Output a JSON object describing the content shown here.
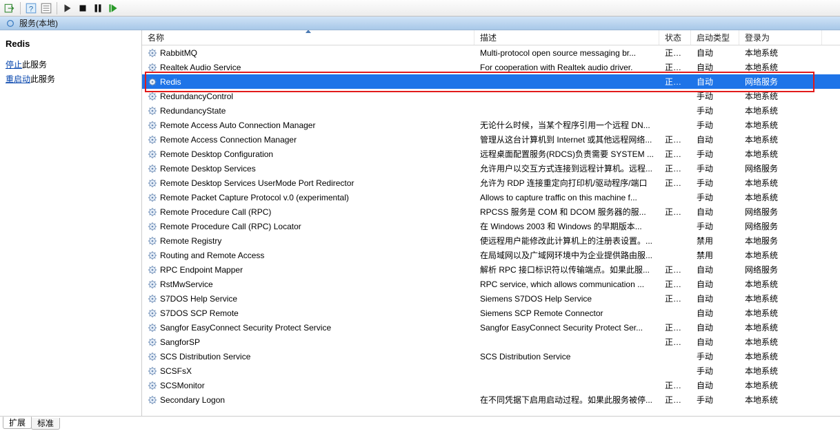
{
  "header": {
    "title": "服务(本地)"
  },
  "left_pane": {
    "title": "Redis",
    "links": [
      {
        "link": "停止",
        "suffix": "此服务"
      },
      {
        "link": "重启动",
        "suffix": "此服务"
      }
    ]
  },
  "columns": {
    "name": "名称",
    "desc": "描述",
    "status": "状态",
    "startup": "启动类型",
    "logon": "登录为"
  },
  "selected_index": 2,
  "services": [
    {
      "name": "RabbitMQ",
      "desc": "Multi-protocol open source messaging br...",
      "status": "正在...",
      "startup": "自动",
      "logon": "本地系统"
    },
    {
      "name": "Realtek Audio Service",
      "desc": "For cooperation with Realtek audio driver.",
      "status": "正在...",
      "startup": "自动",
      "logon": "本地系统"
    },
    {
      "name": "Redis",
      "desc": "",
      "status": "正在...",
      "startup": "自动",
      "logon": "网络服务"
    },
    {
      "name": "RedundancyControl",
      "desc": "",
      "status": "",
      "startup": "手动",
      "logon": "本地系统"
    },
    {
      "name": "RedundancyState",
      "desc": "",
      "status": "",
      "startup": "手动",
      "logon": "本地系统"
    },
    {
      "name": "Remote Access Auto Connection Manager",
      "desc": "无论什么时候，当某个程序引用一个远程 DN...",
      "status": "",
      "startup": "手动",
      "logon": "本地系统"
    },
    {
      "name": "Remote Access Connection Manager",
      "desc": "管理从这台计算机到 Internet 或其他远程网络...",
      "status": "正在...",
      "startup": "自动",
      "logon": "本地系统"
    },
    {
      "name": "Remote Desktop Configuration",
      "desc": "远程桌面配置服务(RDCS)负责需要 SYSTEM ...",
      "status": "正在...",
      "startup": "手动",
      "logon": "本地系统"
    },
    {
      "name": "Remote Desktop Services",
      "desc": "允许用户以交互方式连接到远程计算机。远程...",
      "status": "正在...",
      "startup": "手动",
      "logon": "网络服务"
    },
    {
      "name": "Remote Desktop Services UserMode Port Redirector",
      "desc": "允许为 RDP 连接重定向打印机/驱动程序/端口",
      "status": "正在...",
      "startup": "手动",
      "logon": "本地系统"
    },
    {
      "name": "Remote Packet Capture Protocol v.0 (experimental)",
      "desc": "Allows to capture traffic on this machine f...",
      "status": "",
      "startup": "手动",
      "logon": "本地系统"
    },
    {
      "name": "Remote Procedure Call (RPC)",
      "desc": "RPCSS 服务是 COM 和 DCOM 服务器的服...",
      "status": "正在...",
      "startup": "自动",
      "logon": "网络服务"
    },
    {
      "name": "Remote Procedure Call (RPC) Locator",
      "desc": "在 Windows 2003 和 Windows 的早期版本...",
      "status": "",
      "startup": "手动",
      "logon": "网络服务"
    },
    {
      "name": "Remote Registry",
      "desc": "使远程用户能修改此计算机上的注册表设置。...",
      "status": "",
      "startup": "禁用",
      "logon": "本地服务"
    },
    {
      "name": "Routing and Remote Access",
      "desc": "在局域网以及广域网环境中为企业提供路由服...",
      "status": "",
      "startup": "禁用",
      "logon": "本地系统"
    },
    {
      "name": "RPC Endpoint Mapper",
      "desc": "解析 RPC 接口标识符以传输端点。如果此服...",
      "status": "正在...",
      "startup": "自动",
      "logon": "网络服务"
    },
    {
      "name": "RstMwService",
      "desc": "RPC service, which allows communication ...",
      "status": "正在...",
      "startup": "自动",
      "logon": "本地系统"
    },
    {
      "name": "S7DOS Help Service",
      "desc": "Siemens S7DOS Help Service",
      "status": "正在...",
      "startup": "自动",
      "logon": "本地系统"
    },
    {
      "name": "S7DOS SCP Remote",
      "desc": "Siemens SCP Remote Connector",
      "status": "",
      "startup": "自动",
      "logon": "本地系统"
    },
    {
      "name": "Sangfor EasyConnect Security Protect Service",
      "desc": "Sangfor EasyConnect Security Protect Ser...",
      "status": "正在...",
      "startup": "自动",
      "logon": "本地系统"
    },
    {
      "name": "SangforSP",
      "desc": "",
      "status": "正在...",
      "startup": "自动",
      "logon": "本地系统"
    },
    {
      "name": "SCS Distribution Service",
      "desc": "SCS Distribution Service",
      "status": "",
      "startup": "手动",
      "logon": "本地系统"
    },
    {
      "name": "SCSFsX",
      "desc": "",
      "status": "",
      "startup": "手动",
      "logon": "本地系统"
    },
    {
      "name": "SCSMonitor",
      "desc": "",
      "status": "正在...",
      "startup": "自动",
      "logon": "本地系统"
    },
    {
      "name": "Secondary Logon",
      "desc": "在不同凭据下启用启动过程。如果此服务被停...",
      "status": "正在...",
      "startup": "手动",
      "logon": "本地系统"
    }
  ],
  "tabs": {
    "extended": "扩展",
    "standard": "标准"
  }
}
